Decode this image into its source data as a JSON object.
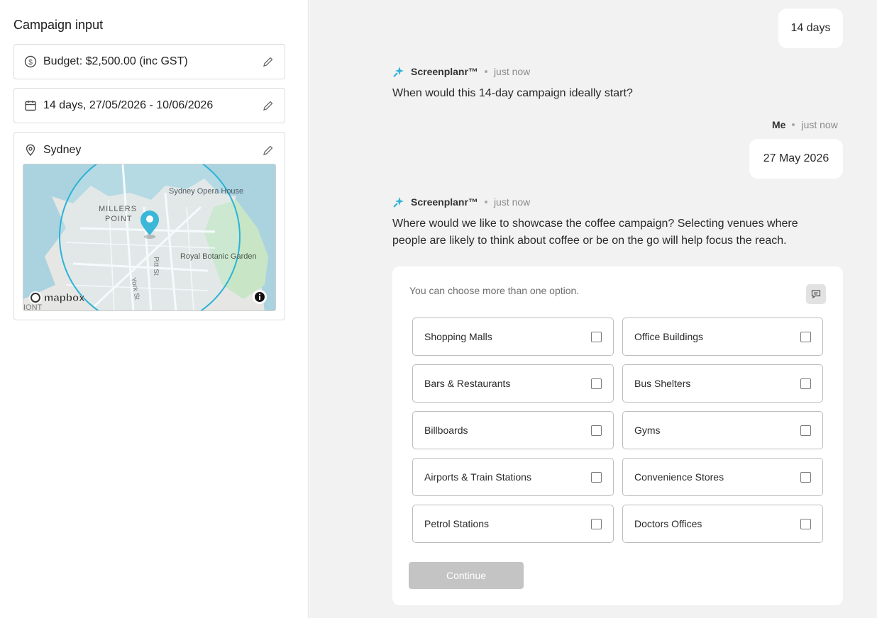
{
  "sidebar": {
    "title": "Campaign input",
    "budget": {
      "text": "Budget: $2,500.00 (inc GST)",
      "icon": "dollar-circle-icon"
    },
    "dates": {
      "text": "14 days,  27/05/2026 - 10/06/2026",
      "icon": "calendar-icon"
    },
    "location": {
      "text": "Sydney",
      "icon": "map-pin-icon",
      "map": {
        "labels": {
          "opera_house": "Sydney Opera House",
          "millers": "MILLERS",
          "point": "POINT",
          "botanic": "Royal Botanic Garden",
          "pitt": "Pitt St",
          "york": "York St",
          "corner": "IONT",
          "brand": "mapbox"
        }
      }
    }
  },
  "chat": {
    "user_msg_1": "14 days",
    "bot_name": "Screenplanr™",
    "time_label": "just now",
    "bot_msg_1": "When would this 14-day campaign ideally start?",
    "me_name": "Me",
    "user_msg_2": "27 May 2026",
    "bot_msg_2_line1": "Where would we like to showcase the coffee campaign? Selecting venues where",
    "bot_msg_2_line2": "people are likely to think about coffee or be on the go will help focus the reach.",
    "hint": "You can choose more than one option.",
    "options": [
      {
        "label": "Shopping Malls",
        "checked": false
      },
      {
        "label": "Office Buildings",
        "checked": false
      },
      {
        "label": "Bars & Restaurants",
        "checked": false
      },
      {
        "label": "Bus Shelters",
        "checked": false
      },
      {
        "label": "Billboards",
        "checked": false
      },
      {
        "label": "Gyms",
        "checked": false
      },
      {
        "label": "Airports & Train Stations",
        "checked": false
      },
      {
        "label": "Convenience Stores",
        "checked": false
      },
      {
        "label": "Petrol Stations",
        "checked": false
      },
      {
        "label": "Doctors Offices",
        "checked": false
      }
    ],
    "continue_label": "Continue"
  },
  "colors": {
    "accent": "#2bb3d6",
    "button_disabled": "#c4c4c4",
    "panel_bg": "#f2f2f2"
  }
}
